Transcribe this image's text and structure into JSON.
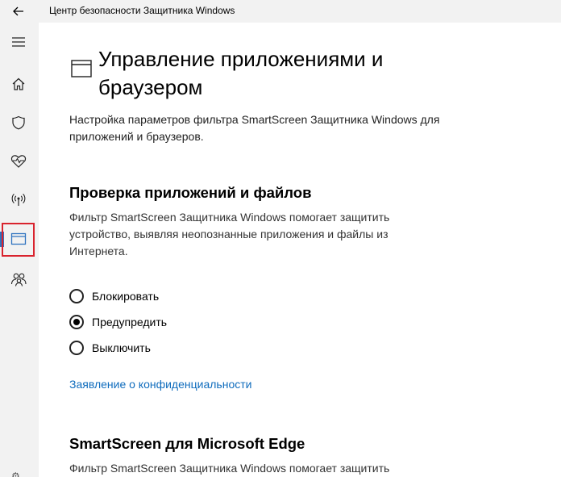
{
  "window": {
    "title": "Центр безопасности Защитника Windows"
  },
  "sidebar": {
    "items": [
      {
        "icon": "hamburger-menu-icon"
      },
      {
        "icon": "home-icon"
      },
      {
        "icon": "shield-icon"
      },
      {
        "icon": "heart-pulse-icon"
      },
      {
        "icon": "wireless-icon"
      },
      {
        "icon": "app-browser-icon",
        "active": true
      },
      {
        "icon": "family-icon"
      }
    ],
    "active_color": "#2f73c0",
    "highlight_color": "#d9232e"
  },
  "page": {
    "title": "Управление приложениями и браузером",
    "description": "Настройка параметров фильтра SmartScreen Защитника Windows для приложений и браузеров."
  },
  "section_apps": {
    "title": "Проверка приложений и файлов",
    "description": "Фильтр SmartScreen Защитника Windows помогает защитить устройство, выявляя неопознанные приложения и файлы из Интернета.",
    "options": [
      {
        "label": "Блокировать",
        "selected": false
      },
      {
        "label": "Предупредить",
        "selected": true
      },
      {
        "label": "Выключить",
        "selected": false
      }
    ]
  },
  "privacy_link": "Заявление о конфиденциальности",
  "section_edge": {
    "title": "SmartScreen для Microsoft Edge",
    "description": "Фильтр SmartScreen Защитника Windows помогает защитить"
  },
  "colors": {
    "link": "#0f6cbd",
    "chrome_bg": "#f2f2f2"
  }
}
